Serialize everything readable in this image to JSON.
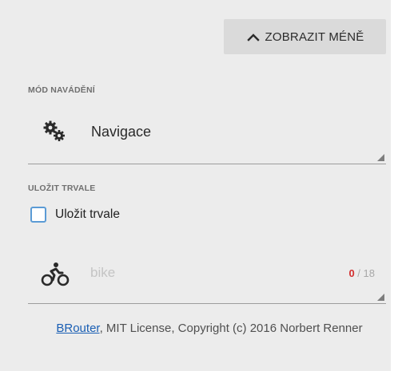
{
  "header": {
    "toggle_label": "ZOBRAZIT MÉNĚ"
  },
  "routing_mode": {
    "section_label": "MÓD NAVÁDĚNÍ",
    "selected_value": "Navigace",
    "icon": "gears-icon"
  },
  "save": {
    "section_label": "ULOŽIT TRVALE",
    "checkbox_label": "Uložit trvale",
    "checked": false
  },
  "name_field": {
    "icon": "bike-icon",
    "value": "",
    "placeholder": "bike",
    "counter_current": "0",
    "counter_separator": " / ",
    "counter_max": "18"
  },
  "footer": {
    "link_text": "BRouter",
    "text": ", MIT License, Copyright (c) 2016 Norbert Renner"
  },
  "colors": {
    "panel_bg": "#ececec",
    "button_bg": "#dadada",
    "checkbox_border": "#5b9bd5",
    "counter_current": "#d32f2f",
    "link": "#1a5fb4"
  }
}
